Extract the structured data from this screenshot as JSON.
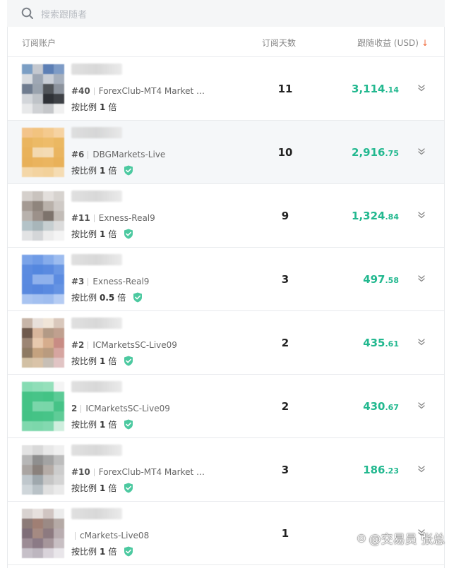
{
  "search": {
    "placeholder": "搜索跟随者"
  },
  "table_header": {
    "account": "订阅账户",
    "days": "订阅天数",
    "earnings": "跟随收益 (USD)"
  },
  "rows": [
    {
      "rank": "#40",
      "broker": "ForexClub-MT4 Market Re...",
      "ratio_label": "按比例",
      "ratio_value": "1",
      "ratio_unit": "倍",
      "verified": false,
      "days": "11",
      "earn_int": "3,114",
      "earn_dec": ".14",
      "avatar": [
        "#7b9ec4",
        "#c4c8cf",
        "#5c7fb5",
        "#7d9bc6",
        "#d9dce0",
        "#9ea7b4",
        "#c9ced6",
        "#a7b0bd",
        "#6f7c8f",
        "#9aa3ae",
        "#505459",
        "#8c939d",
        "#d3d6da",
        "#bfc3c8",
        "#2f3237",
        "#3e4146",
        "#e8e9ea",
        "#d0d2d5",
        "#c5c7ca",
        "#f0f0f0"
      ]
    },
    {
      "rank": "#6",
      "broker": "DBGMarkets-Live",
      "ratio_label": "按比例",
      "ratio_value": "1",
      "ratio_unit": "倍",
      "verified": true,
      "days": "10",
      "earn_int": "2,916",
      "earn_dec": ".75",
      "avatar": [
        "#f3c48a",
        "#f2c37f",
        "#f4ca8e",
        "#f6d3a2",
        "#eab55f",
        "#ecba66",
        "#eebc6a",
        "#ebb862",
        "#e9b25a",
        "#f3d9b0",
        "#f4dbb4",
        "#eab560",
        "#e8b058",
        "#eab35d",
        "#ebb560",
        "#e9b159",
        "#f4d7a8",
        "#f3d3a0",
        "#f2d19b",
        "#f5dcb3"
      ]
    },
    {
      "rank": "#11",
      "broker": "Exness-Real9",
      "ratio_label": "按比例",
      "ratio_value": "1",
      "ratio_unit": "倍",
      "verified": true,
      "days": "9",
      "earn_int": "1,324",
      "earn_dec": ".84",
      "avatar": [
        "#d5d0cc",
        "#c9c3be",
        "#e3dfdc",
        "#d7d3cf",
        "#a49a93",
        "#8f857d",
        "#b9b1aa",
        "#cfcac6",
        "#b8b2ad",
        "#9c918a",
        "#7d736c",
        "#c2bcb7",
        "#b4c3c8",
        "#a8b6ba",
        "#c7cfd1",
        "#dcdcdc",
        "#e2e3e4",
        "#d4d6d8",
        "#ececec",
        "#f4f4f4"
      ]
    },
    {
      "rank": "#3",
      "broker": "Exness-Real9",
      "ratio_label": "按比例",
      "ratio_value": "0.5",
      "ratio_unit": "倍",
      "verified": true,
      "days": "3",
      "earn_int": "497",
      "earn_dec": ".58",
      "avatar": [
        "#7aa3e8",
        "#6f9be6",
        "#86aceb",
        "#9dbcef",
        "#5b8be0",
        "#5487df",
        "#5a8ae0",
        "#6a97e4",
        "#5a8ae0",
        "#8fb1ec",
        "#8fb1ec",
        "#5c8ce1",
        "#5989df",
        "#5686de",
        "#5a8ae0",
        "#6593e3",
        "#a9c4f1",
        "#a3c0f0",
        "#9fbdef",
        "#b5ccf3"
      ]
    },
    {
      "rank": "#2",
      "broker": "ICMarketsSC-Live09",
      "ratio_label": "按比例",
      "ratio_value": "1",
      "ratio_unit": "倍",
      "verified": true,
      "days": "2",
      "earn_int": "435",
      "earn_dec": ".61",
      "avatar": [
        "#c7b5a8",
        "#e8e0da",
        "#f0e5d8",
        "#d9c8bc",
        "#6f5a4d",
        "#d8b69c",
        "#b39a86",
        "#c0a08f",
        "#9c8574",
        "#e7c9ae",
        "#d6ad8d",
        "#c88c84",
        "#8e7a63",
        "#c4a27f",
        "#b99b7f",
        "#d6a5a0",
        "#d2c0a4",
        "#d9c3a8",
        "#c7bfb6",
        "#e1c4c4"
      ]
    },
    {
      "rank": "2",
      "broker": "ICMarketsSC-Live09",
      "ratio_label": "按比例",
      "ratio_value": "1",
      "ratio_unit": "倍",
      "verified": true,
      "days": "2",
      "earn_int": "430",
      "earn_dec": ".67",
      "avatar": [
        "#86dcb3",
        "#8fdeb8",
        "#95e0bb",
        "#f4f4f4",
        "#45c386",
        "#47c488",
        "#43c385",
        "#5ccb96",
        "#44c386",
        "#7ad6aa",
        "#79d6a9",
        "#46c387",
        "#43c285",
        "#45c386",
        "#47c488",
        "#5fcc97",
        "#7fd8ad",
        "#7cd7ab",
        "#83d9b0",
        "#cfeede"
      ]
    },
    {
      "rank": "#10",
      "broker": "ForexClub-MT4 Market Re...",
      "ratio_label": "按比例",
      "ratio_value": "1",
      "ratio_unit": "倍",
      "verified": true,
      "days": "3",
      "earn_int": "186",
      "earn_dec": ".23",
      "avatar": [
        "#e3e3e3",
        "#d9d9d9",
        "#e8e8e8",
        "#f0f0f0",
        "#b7b7b7",
        "#8f8f8f",
        "#a3a3a3",
        "#bdbdbd",
        "#aaa5a2",
        "#8a817c",
        "#b5aca7",
        "#cccccc",
        "#bfc7cc",
        "#9fa8ad",
        "#c6c6c6",
        "#d4d4d4",
        "#cfd6da",
        "#b9c2c7",
        "#e0e0e0",
        "#eaeaea"
      ]
    },
    {
      "rank": "",
      "broker": "cMarkets-Live08",
      "ratio_label": "按比例",
      "ratio_value": "1",
      "ratio_unit": "倍",
      "verified": true,
      "days": "1",
      "earn_int": "",
      "earn_dec": "",
      "avatar": [
        "#d8d2d0",
        "#e6e0dd",
        "#d0c5c2",
        "#ececec",
        "#8c7b78",
        "#a07f74",
        "#9b8a85",
        "#b5aaa6",
        "#7f6e78",
        "#a58a82",
        "#8d7a80",
        "#b9adb0",
        "#9c8c95",
        "#8b7a86",
        "#a6969b",
        "#c8bfc3",
        "#c6c0c8",
        "#bdb6bf",
        "#d9d3da",
        "#e9e6ea"
      ]
    }
  ],
  "watermark": {
    "logo": "⊙",
    "text": "@交易员 张总"
  }
}
